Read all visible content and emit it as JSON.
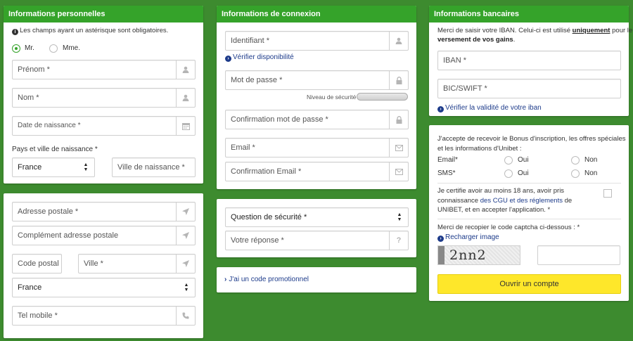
{
  "personal": {
    "title": "Informations personnelles",
    "required_note": "Les champs ayant un astérisque sont obligatoires.",
    "civility": {
      "mr": "Mr.",
      "mme": "Mme.",
      "selected": "mr"
    },
    "firstname": "Prénom *",
    "lastname": "Nom *",
    "birthdate": "Date de naissance *",
    "birth_place_label": "Pays et ville de naissance *",
    "birth_country": "France",
    "birth_city": "Ville de naissance *"
  },
  "address": {
    "street": "Adresse postale *",
    "complement": "Complément adresse postale",
    "postcode": "Code postal",
    "city": "Ville *",
    "country": "France",
    "mobile": "Tel mobile *"
  },
  "connection": {
    "title": "Informations de connexion",
    "identifier": "Identifiant *",
    "check_availability": "Vérifier disponibilité",
    "password": "Mot de passe *",
    "security_level": "Niveau de sécurité",
    "password_confirm": "Confirmation mot de passe *",
    "email": "Email *",
    "email_confirm": "Confirmation Email *"
  },
  "security": {
    "question": "Question de sécurité *",
    "answer": "Votre réponse *",
    "answer_icon": "?"
  },
  "promo": {
    "label": "J'ai un code promotionnel"
  },
  "bank": {
    "title": "Informations bancaires",
    "intro_1": "Merci de saisir votre IBAN. Celui-ci est utilisé",
    "intro_bold_1": "uniquement",
    "intro_2": "pour le",
    "intro_bold_2": "versement de vos gains",
    "intro_end": ".",
    "iban": "IBAN *",
    "bic": "BIC/SWIFT *",
    "verify_iban": "Vérifier la validité de votre iban"
  },
  "consent": {
    "bonus_line1": "J'accepte de recevoir le Bonus d'inscription, les offres spéciales",
    "bonus_line2": "et les informations d'Unibet :",
    "email_label": "Email*",
    "sms_label": "SMS*",
    "yes": "Oui",
    "no": "Non",
    "age_line1": "Je certifie avoir au moins 18 ans, avoir pris",
    "age_line2_a": "connaissance",
    "age_line2_link": "des CGU et des réglements",
    "age_line2_b": "de",
    "age_line3": "UNIBET, et en accepter l'application. *",
    "captcha_prompt": "Merci de recopier le code captcha ci-dessous : *",
    "reload_captcha": "Recharger image",
    "captcha_text": "2nn2",
    "submit": "Ouvrir un compte"
  }
}
